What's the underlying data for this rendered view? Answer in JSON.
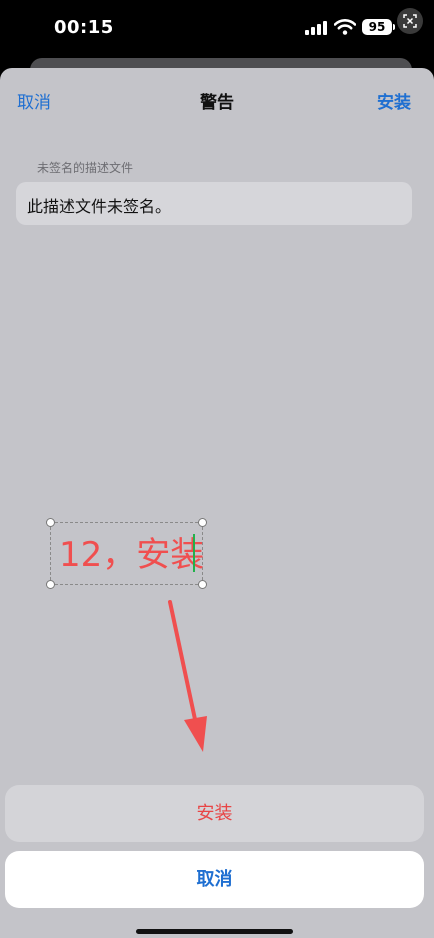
{
  "status_bar": {
    "time": "00:15",
    "battery_level": "95",
    "icons": [
      "signal-icon",
      "wifi-icon",
      "battery-icon",
      "screenshot-icon"
    ]
  },
  "nav": {
    "left_label": "取消",
    "title": "警告",
    "right_label": "安装"
  },
  "profile": {
    "section_header": "未签名的描述文件",
    "message": "此描述文件未签名。"
  },
  "annotation": {
    "text": "12，安装",
    "color": "#f04f4f"
  },
  "action_sheet": {
    "install_label": "安装",
    "cancel_label": "取消"
  },
  "colors": {
    "accent": "#1f6fd1",
    "destructive": "#e84545",
    "sheet_background": "#c4c4c9"
  }
}
